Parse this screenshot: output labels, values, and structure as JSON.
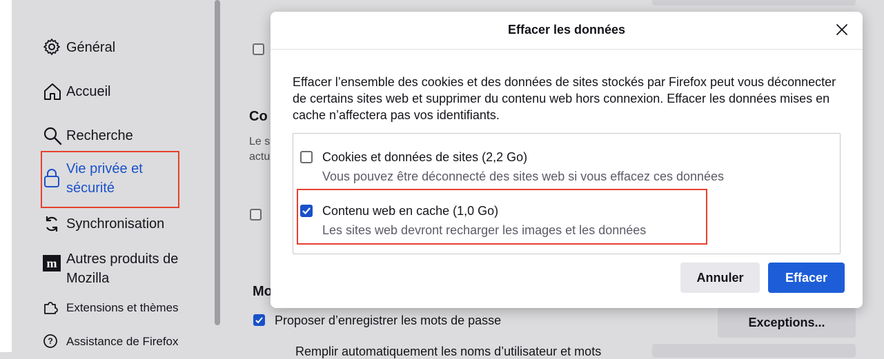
{
  "sidebar": {
    "items": [
      {
        "label": "Général",
        "icon": "gear-icon"
      },
      {
        "label": "Accueil",
        "icon": "home-icon"
      },
      {
        "label": "Recherche",
        "icon": "search-icon"
      },
      {
        "label_line1": "Vie privée et",
        "label_line2": "sécurité",
        "icon": "lock-icon",
        "active": true
      },
      {
        "label": "Synchronisation",
        "icon": "sync-icon"
      },
      {
        "label_line1": "Autres produits de",
        "label_line2": "Mozilla",
        "icon": "mozilla-icon"
      },
      {
        "label": "Extensions et thèmes",
        "icon": "puzzle-icon"
      },
      {
        "label": "Assistance de Firefox",
        "icon": "help-icon"
      }
    ]
  },
  "background": {
    "heading1": "Co",
    "sub1_line1": "Le s",
    "sub1_line2": "actu",
    "heading2": "Mo",
    "save_passwords_label": "Proposer d’enregistrer les mots de passe",
    "autofill_label": "Remplir automatiquement les noms d’utilisateur et mots",
    "exceptions_button": "Exceptions..."
  },
  "dialog": {
    "title": "Effacer les données",
    "description": "Effacer l’ensemble des cookies et des données de sites stockés par Firefox peut vous déconnecter de certains sites web et supprimer du contenu web hors connexion. Effacer les données mises en cache n’affectera pas vos identifiants.",
    "options": [
      {
        "title": "Cookies et données de sites (2,2 Go)",
        "subtitle": "Vous pouvez être déconnecté des sites web si vous effacez ces données",
        "checked": false
      },
      {
        "title": "Contenu web en cache (1,0 Go)",
        "subtitle": "Les sites web devront recharger les images et les données",
        "checked": true
      }
    ],
    "cancel_label": "Annuler",
    "confirm_label": "Effacer"
  },
  "colors": {
    "accent": "#1d5ed8",
    "highlight": "#e6402e",
    "active_link": "#1a51c9"
  }
}
